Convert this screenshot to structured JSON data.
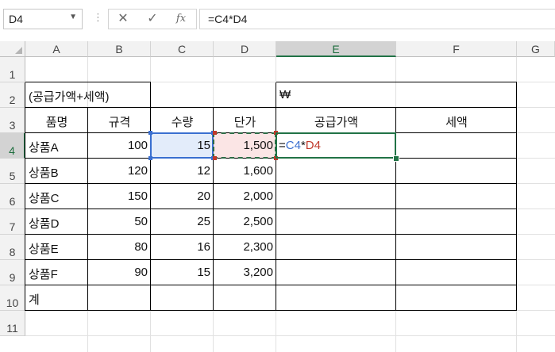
{
  "namebox": {
    "value": "D4"
  },
  "formula_bar": {
    "cancel_icon": "x-icon",
    "enter_icon": "check-icon",
    "fx_label": "fx",
    "formula": "=C4*D4"
  },
  "columns": [
    "A",
    "B",
    "C",
    "D",
    "E",
    "F",
    "G"
  ],
  "rows": [
    "1",
    "2",
    "3",
    "4",
    "5",
    "6",
    "7",
    "8",
    "9",
    "10",
    "11"
  ],
  "selected": {
    "column": "E",
    "row": "4"
  },
  "cells": {
    "A2": "(공급가액+세액)",
    "E2": "₩",
    "headers": [
      "품명",
      "규격",
      "수량",
      "단가",
      "공급가액",
      "세액"
    ],
    "items": [
      {
        "name": "상품A",
        "spec": "100",
        "qty": "15",
        "price": "1,500"
      },
      {
        "name": "상품B",
        "spec": "120",
        "qty": "12",
        "price": "1,600"
      },
      {
        "name": "상품C",
        "spec": "150",
        "qty": "20",
        "price": "2,000"
      },
      {
        "name": "상품D",
        "spec": "50",
        "qty": "25",
        "price": "2,500"
      },
      {
        "name": "상품E",
        "spec": "80",
        "qty": "16",
        "price": "2,300"
      },
      {
        "name": "상품F",
        "spec": "90",
        "qty": "15",
        "price": "3,200"
      }
    ],
    "total_label": "계",
    "E4_edit": {
      "eq": "=",
      "ref1": "C4",
      "op": "*",
      "ref2": "D4"
    }
  },
  "colors": {
    "ref_blue": "#3a6fd0",
    "ref_red": "#c0392b",
    "active_green": "#217346"
  }
}
